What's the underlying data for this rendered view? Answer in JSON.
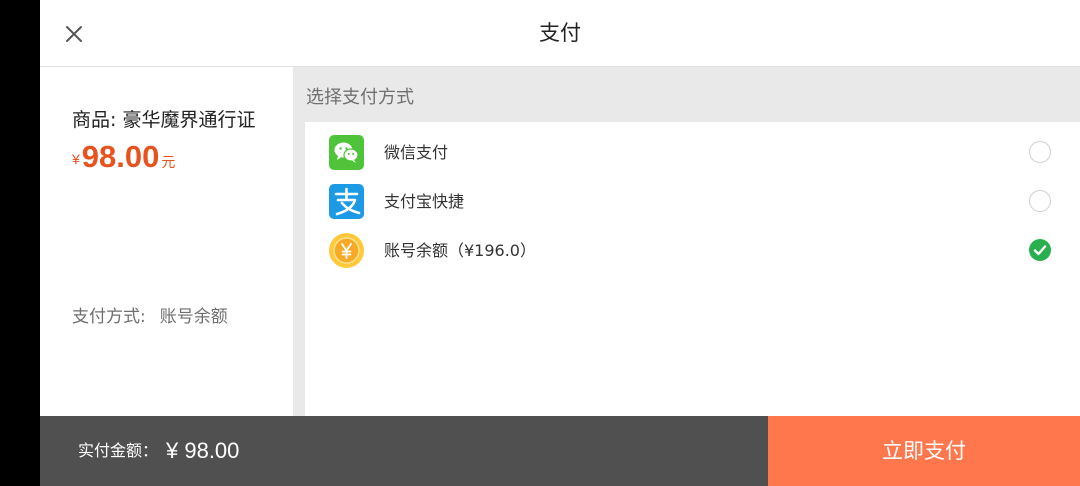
{
  "header": {
    "title": "支付",
    "close_icon": "close-icon"
  },
  "summary": {
    "product_label": "商品: 豪华魔界通行证",
    "price_currency": "¥",
    "price_amount": "98.00",
    "price_unit": "元",
    "method_label": "支付方式:",
    "method_value": "账号余额"
  },
  "payment": {
    "section_title": "选择支付方式",
    "options": [
      {
        "label": "微信支付",
        "icon": "wechat-icon",
        "selected": false
      },
      {
        "label": "支付宝快捷",
        "icon": "alipay-icon",
        "selected": false
      },
      {
        "label": "账号余额（¥196.0）",
        "icon": "balance-icon",
        "selected": true
      }
    ]
  },
  "footer": {
    "total_label": "实付金额：",
    "total_value": "¥ 98.00",
    "pay_button": "立即支付"
  },
  "colors": {
    "price": "#e8521f",
    "pay_button": "#ff774d",
    "bottom_bar": "#505050",
    "selected_radio": "#28b04f"
  }
}
